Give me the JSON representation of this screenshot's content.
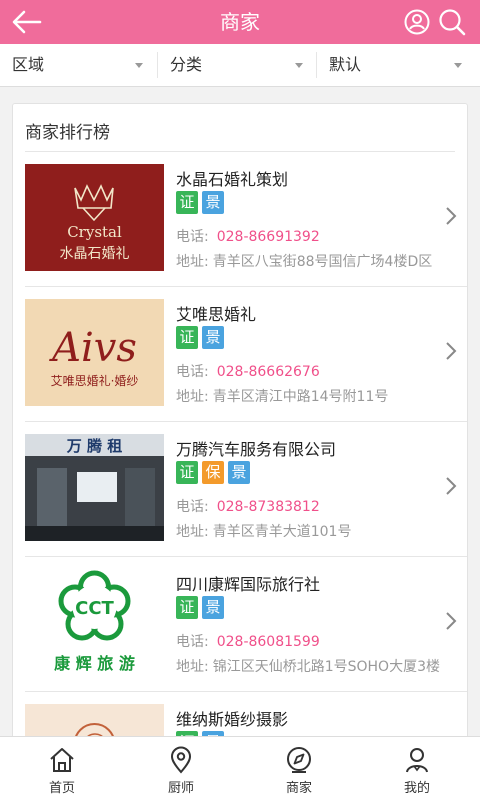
{
  "colors": {
    "header": "#f06c9b",
    "phone": "#f0508a",
    "tag_green": "#38b558",
    "tag_blue": "#4aa3df",
    "tag_orange": "#f39a2b"
  },
  "header": {
    "title": "商家",
    "back_icon": "back-arrow-icon",
    "user_icon": "user-icon",
    "search_icon": "search-icon"
  },
  "filters": [
    {
      "label": "区域"
    },
    {
      "label": "分类"
    },
    {
      "label": "默认"
    }
  ],
  "section_title": "商家排行榜",
  "phone_label": "电话:",
  "address_label": "地址:",
  "merchants": [
    {
      "name": "水晶石婚礼策划",
      "tags": [
        "证",
        "景"
      ],
      "phone": "028-86691392",
      "address": "青羊区八宝街88号国信广场4楼D区",
      "logo": {
        "line1": "Crystal",
        "line2": "水晶石婚礼"
      }
    },
    {
      "name": "艾唯思婚礼",
      "tags": [
        "证",
        "景"
      ],
      "phone": "028-86662676",
      "address": "青羊区清江中路14号附11号",
      "logo": {
        "line1": "Aivs",
        "line2": "艾唯思婚礼·婚纱"
      }
    },
    {
      "name": "万腾汽车服务有限公司",
      "tags": [
        "证",
        "保",
        "景"
      ],
      "phone": "028-87383812",
      "address": "青羊区青羊大道101号",
      "logo": {
        "line1": "万 腾 租"
      }
    },
    {
      "name": "四川康辉国际旅行社",
      "tags": [
        "证",
        "景"
      ],
      "phone": "028-86081599",
      "address": "锦江区天仙桥北路1号SOHO大厦3楼",
      "logo": {
        "line1": "CCT",
        "line2": "康 辉 旅 游"
      }
    },
    {
      "name": "维纳斯婚纱摄影",
      "tags": [
        "证",
        "景"
      ],
      "phone": "",
      "address": ""
    }
  ],
  "tabbar": [
    {
      "label": "首页",
      "icon": "home-icon"
    },
    {
      "label": "厨师",
      "icon": "location-pin-icon"
    },
    {
      "label": "商家",
      "icon": "compass-icon"
    },
    {
      "label": "我的",
      "icon": "profile-icon"
    }
  ]
}
